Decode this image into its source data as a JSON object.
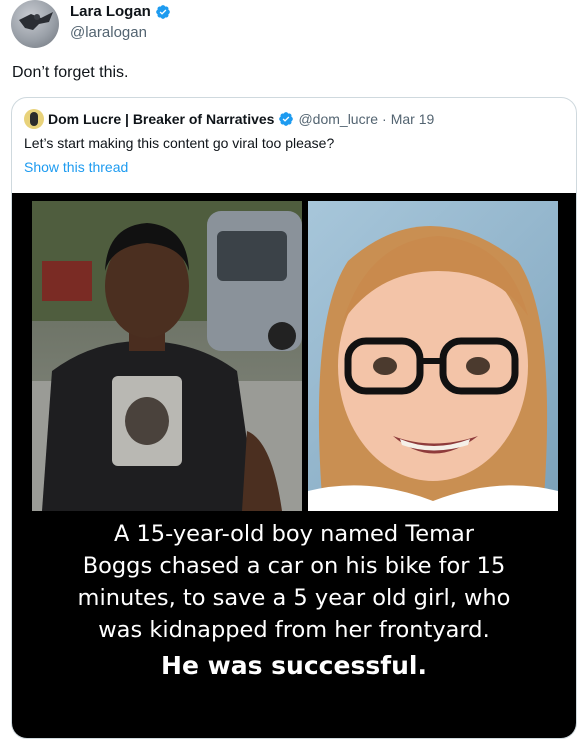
{
  "author": {
    "name": "Lara Logan",
    "handle": "@laralogan",
    "avatar_icon": "profile-photo"
  },
  "tweet": {
    "text": "Don’t forget this."
  },
  "quoted": {
    "name": "Dom Lucre | Breaker of Narratives",
    "handle": "@dom_lucre",
    "separator": "·",
    "date": "Mar 19",
    "text": "Let’s start making this content go viral too please?",
    "show_thread": "Show this thread",
    "media": {
      "caption_lines": [
        "A 15-year-old boy named Temar",
        "Boggs chased a car on his bike for 15",
        "minutes, to save a 5 year old girl, who",
        "was kidnapped from her frontyard."
      ],
      "caption_final": "He was successful."
    }
  },
  "colors": {
    "verified": "#1d9bf0",
    "link": "#1d9bf0",
    "secondary_text": "#536471",
    "border": "#cfd9de"
  }
}
